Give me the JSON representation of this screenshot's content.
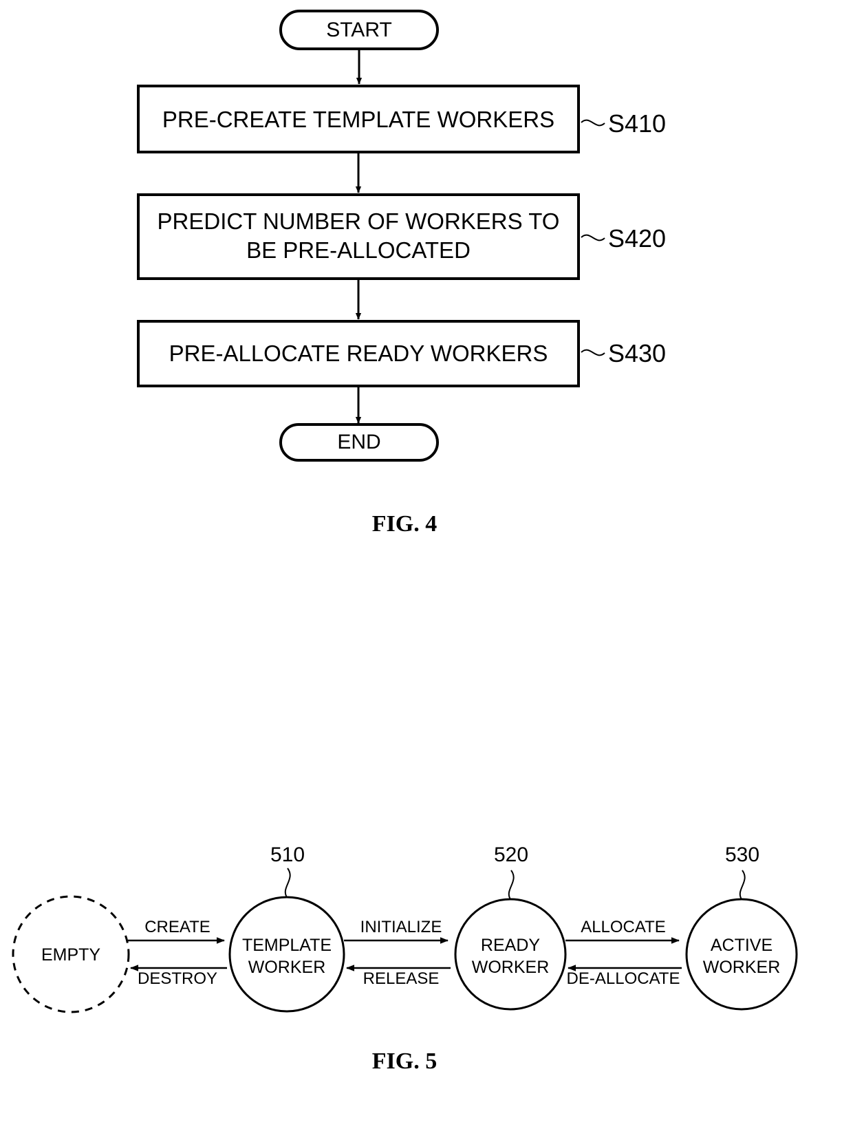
{
  "figures": [
    {
      "id": "fig4",
      "caption": "FIG. 4",
      "type": "flowchart",
      "nodes": [
        {
          "id": "start",
          "shape": "terminator",
          "label": "START"
        },
        {
          "id": "s410",
          "shape": "process",
          "label": "PRE-CREATE TEMPLATE WORKERS",
          "step": "S410"
        },
        {
          "id": "s420",
          "shape": "process",
          "label_line1": "PREDICT NUMBER OF WORKERS TO",
          "label_line2": "BE PRE-ALLOCATED",
          "step": "S420"
        },
        {
          "id": "s430",
          "shape": "process",
          "label": "PRE-ALLOCATE READY WORKERS",
          "step": "S430"
        },
        {
          "id": "end",
          "shape": "terminator",
          "label": "END"
        }
      ]
    },
    {
      "id": "fig5",
      "caption": "FIG. 5",
      "type": "state-diagram",
      "states": [
        {
          "id": "empty",
          "line1": "EMPTY",
          "line2": "",
          "ref": "",
          "style": "dashed"
        },
        {
          "id": "template",
          "line1": "TEMPLATE",
          "line2": "WORKER",
          "ref": "510",
          "style": "solid"
        },
        {
          "id": "ready",
          "line1": "READY",
          "line2": "WORKER",
          "ref": "520",
          "style": "solid"
        },
        {
          "id": "active",
          "line1": "ACTIVE",
          "line2": "WORKER",
          "ref": "530",
          "style": "solid"
        }
      ],
      "transitions": [
        {
          "id": "create",
          "label": "CREATE",
          "from": "empty",
          "to": "template",
          "direction": "forward"
        },
        {
          "id": "destroy",
          "label": "DESTROY",
          "from": "template",
          "to": "empty",
          "direction": "backward"
        },
        {
          "id": "initialize",
          "label": "INITIALIZE",
          "from": "template",
          "to": "ready",
          "direction": "forward"
        },
        {
          "id": "release",
          "label": "RELEASE",
          "from": "ready",
          "to": "template",
          "direction": "backward"
        },
        {
          "id": "allocate",
          "label": "ALLOCATE",
          "from": "ready",
          "to": "active",
          "direction": "forward"
        },
        {
          "id": "deallocate",
          "label": "DE-ALLOCATE",
          "from": "active",
          "to": "ready",
          "direction": "backward"
        }
      ]
    }
  ],
  "colors": {
    "ink": "#000000",
    "paper": "#ffffff"
  }
}
